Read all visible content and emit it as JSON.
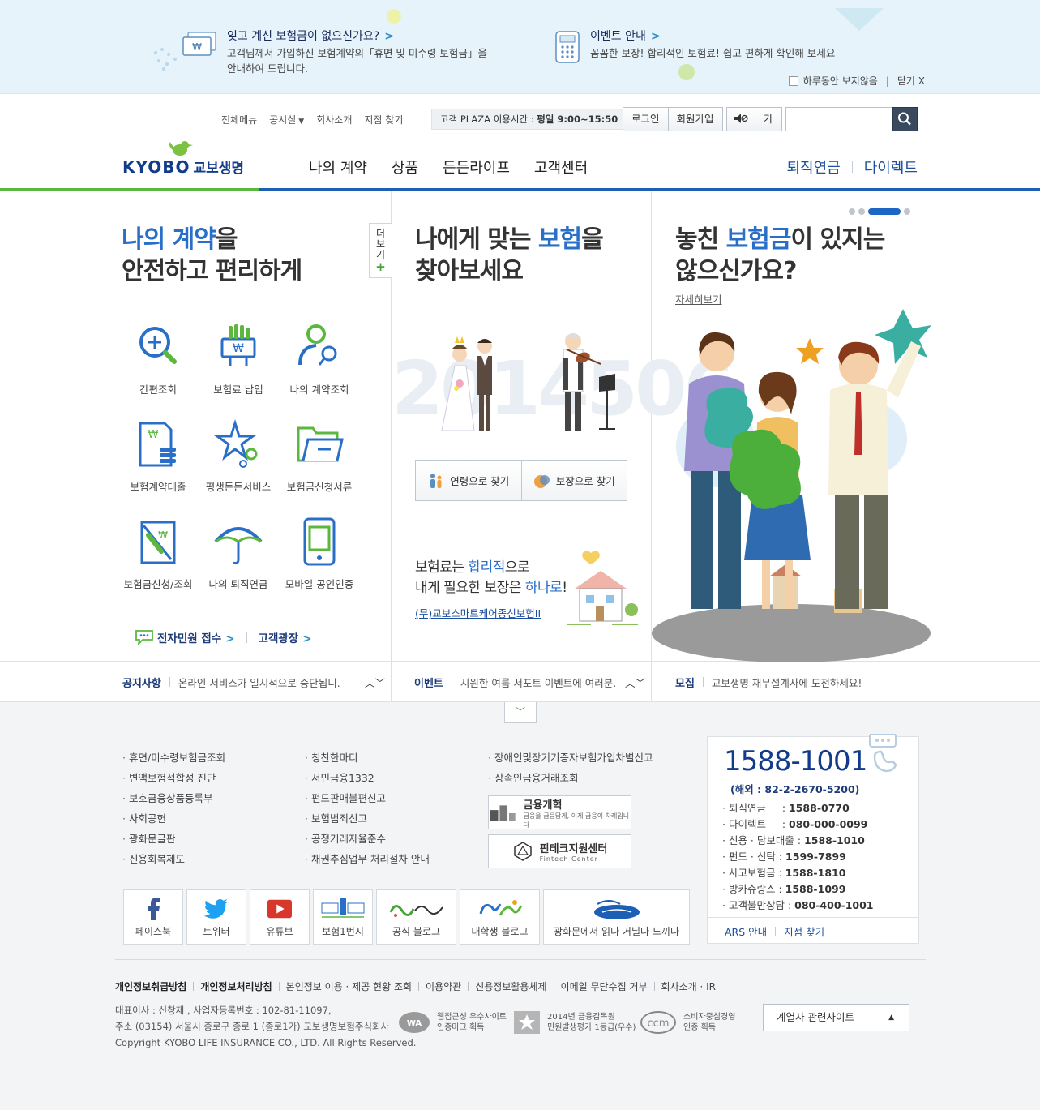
{
  "banner": {
    "left_title": "잊고 계신 보험금이 없으신가요?",
    "left_desc_1": "고객님께서 가입하신 보험계약의「휴면 및 미수령 보험금」을",
    "left_desc_2": "안내하여 드립니다.",
    "right_title": "이벤트 안내",
    "right_desc": "꼼꼼한 보장! 합리적인 보험료! 쉽고 편하게 확인해 보세요",
    "hide_today": "하루동안 보지않음",
    "close": "닫기 X",
    "chevron": ">"
  },
  "header": {
    "util_links": [
      "전체메뉴",
      "공시실",
      "회사소개",
      "지점 찾기"
    ],
    "plaza_label": "고객 PLAZA 이용시간 : ",
    "plaza_hours": "평일 9:00~15:50",
    "login": "로그인",
    "join": "회원가입",
    "font_size": "가",
    "search_placeholder": "",
    "logo_en": "KYOBO",
    "logo_ko": "교보생명",
    "gnb": [
      "나의 계약",
      "상품",
      "든든라이프",
      "고객센터"
    ],
    "gnb_right": [
      "퇴직연금",
      "다이렉트"
    ]
  },
  "contract_panel": {
    "title_hl": "나의 계약",
    "title_rest": "을",
    "title_line2": "안전하고 편리하게",
    "more_tab": [
      "더",
      "보",
      "기"
    ],
    "more_plus": "+",
    "services": [
      "간편조회",
      "보험료 납입",
      "나의 계약조회",
      "보험계약대출",
      "평생든든서비스",
      "보험금신청서류",
      "보험금신청/조회",
      "나의 퇴직연금",
      "모바일 공인인증"
    ],
    "quick_links": [
      "전자민원 접수",
      "고객광장"
    ]
  },
  "product_panel": {
    "title_pre": "나에게 맞는 ",
    "title_hl": "보험",
    "title_post": "을",
    "title_line2": "찾아보세요",
    "bg_numbers": "2014506",
    "find_age": "연령으로 찾기",
    "find_coverage": "보장으로 찾기",
    "promo_l1_pre": "보험료는 ",
    "promo_l1_hl": "합리적",
    "promo_l1_post": "으로",
    "promo_l2_pre": "내게 필요한 보장은 ",
    "promo_l2_hl": "하나로",
    "promo_l2_post": "!",
    "promo_link": "(무)교보스마트케어종신보험II"
  },
  "unclaimed_panel": {
    "title_pre": "놓친 ",
    "title_hl": "보험금",
    "title_post": "이 있지는",
    "title_line2": "않으신가요?",
    "detail_link": "자세히보기",
    "slide_count": 4,
    "active_slide": 3
  },
  "notices": [
    {
      "label": "공지사항",
      "text": "온라인 서비스가 일시적으로 중단됩니."
    },
    {
      "label": "이벤트",
      "text": "시원한 여름 서포트 이벤트에 여러분."
    },
    {
      "label": "모집",
      "text": "교보생명 재무설계사에 도전하세요!"
    }
  ],
  "footer": {
    "col1": [
      "휴면/미수령보험금조회",
      "변액보험적합성 진단",
      "보호금융상품등록부",
      "사회공헌",
      "광화문글판",
      "신용회복제도"
    ],
    "col2": [
      "칭찬한마디",
      "서민금융1332",
      "펀드판매불편신고",
      "보험범죄신고",
      "공정거래자율준수",
      "채권추심업무 처리절차 안내"
    ],
    "col3": [
      "장애인및장기기증자보험가입차별신고",
      "상속인금융거래조회"
    ],
    "badge_finance": "금융개혁",
    "badge_finance_sub": "금융을 금융답게, 이제 금융이 차례입니다",
    "badge_fintech": "핀테크지원센터",
    "badge_fintech_sub": "Fintech Center",
    "social": [
      "페이스북",
      "트위터",
      "유튜브",
      "보험1번지",
      "공식 블로그",
      "대학생 블로그",
      "광화문에서 읽다 거닐다 느끼다"
    ],
    "call_main": "1588-1001",
    "call_overseas": "(해외 : 82-2-2670-5200)",
    "call_list": [
      {
        "label": "퇴직연금",
        "num": "1588-0770",
        "pad": "     : "
      },
      {
        "label": "다이렉트",
        "num": "080-000-0099",
        "pad": "     : "
      },
      {
        "label": "신용 · 담보대출",
        "num": "1588-1010",
        "pad": " : "
      },
      {
        "label": "펀드 · 신탁",
        "num": "1599-7899",
        "pad": " : "
      },
      {
        "label": "사고보험금",
        "num": "1588-1810",
        "pad": " : "
      },
      {
        "label": "방카슈랑스",
        "num": "1588-1099",
        "pad": " : "
      },
      {
        "label": "고객불만상담",
        "num": "080-400-1001",
        "pad": " : "
      }
    ],
    "ars": "ARS 안내",
    "branch": "지점 찾기",
    "policy_links": [
      "개인정보취급방침",
      "개인정보처리방침",
      "본인정보 이용 · 제공 현황 조회",
      "이용약관",
      "신용정보활용체제",
      "이메일 무단수집 거부",
      "회사소개 · IR"
    ],
    "company_l1": "대표이사 : 신창재 , 사업자등록번호 : 102-81-11097,",
    "company_l2": "주소 (03154) 서울시 종로구 종로 1 (종로1가) 교보생명보험주식회사",
    "company_l3": "Copyright KYOBO LIFE INSURANCE CO., LTD. All Rights Reserved.",
    "cert1": [
      "웹접근성 우수사이트",
      "인증마크 획득"
    ],
    "cert2": [
      "2014년 금융감독원",
      "민원발생평가 1등급(우수)"
    ],
    "cert3": [
      "소비자중심경영",
      "인증 획득"
    ],
    "family_site": "계열사 관련사이트"
  },
  "colors": {
    "brand_blue": "#1c5fb4",
    "brand_green": "#5bb73e",
    "navy": "#123c8b",
    "highlight_blue": "#2a6fc7"
  }
}
